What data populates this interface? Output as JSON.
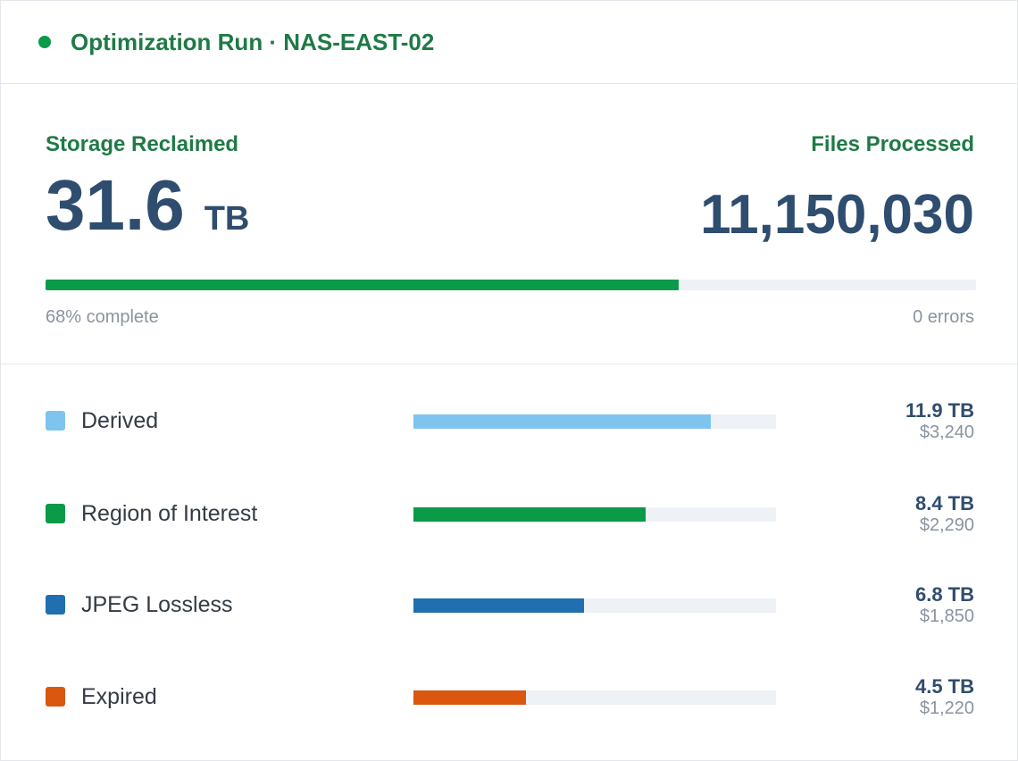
{
  "header": {
    "status_color": "#0a9a48",
    "title": "Optimization Run · NAS-EAST-02"
  },
  "metrics": {
    "storage_label": "Storage Reclaimed",
    "storage_value": "31.6",
    "storage_unit": "TB",
    "files_label": "Files Processed",
    "files_value": "11,150,030",
    "progress_fraction": 0.68,
    "progress_text": "68% complete",
    "errors_text": "0 errors"
  },
  "categories": [
    {
      "label": "Derived",
      "color": "#7fc4ef",
      "fraction": 0.82,
      "tb": "11.9 TB",
      "cost": "$3,240"
    },
    {
      "label": "Region of Interest",
      "color": "#0a9a48",
      "fraction": 0.64,
      "tb": "8.4 TB",
      "cost": "$2,290"
    },
    {
      "label": "JPEG Lossless",
      "color": "#1f6fb1",
      "fraction": 0.47,
      "tb": "6.8 TB",
      "cost": "$1,850"
    },
    {
      "label": "Expired",
      "color": "#d9570f",
      "fraction": 0.31,
      "tb": "4.5 TB",
      "cost": "$1,220"
    }
  ]
}
